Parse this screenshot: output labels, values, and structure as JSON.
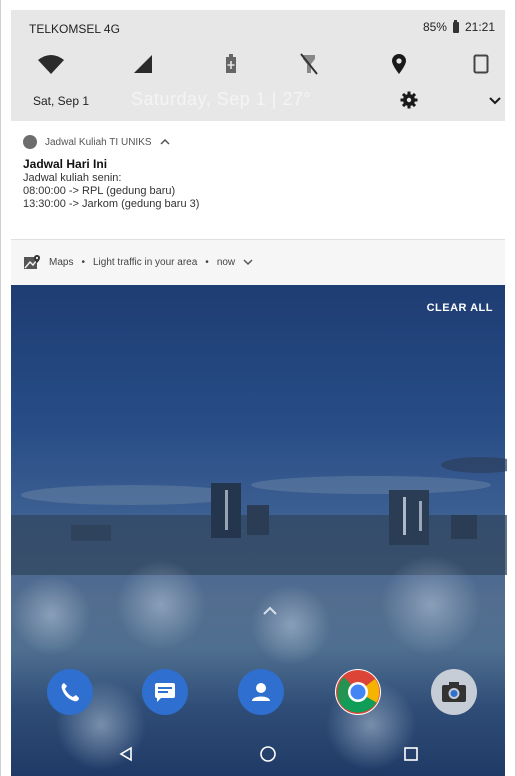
{
  "status_bar": {
    "carrier": "TELKOMSEL 4G",
    "battery": "85%",
    "time": "21:21"
  },
  "quick_settings": {
    "date": "Sat, Sep 1",
    "ghost_text": "Saturday, Sep 1 | 27°",
    "tiles": [
      "wifi-icon",
      "cellular-signal-icon",
      "battery-saver-icon",
      "flashlight-off-icon",
      "location-icon",
      "auto-rotate-icon"
    ]
  },
  "notifications": [
    {
      "app": "Jadwal Kuliah TI UNIKS",
      "title": "Jadwal Hari Ini",
      "lines": [
        "Jadwal kuliah senin:",
        "08:00:00 -> RPL (gedung baru)",
        "13:30:00 -> Jarkom (gedung baru 3)"
      ]
    },
    {
      "app": "Maps",
      "text": "Light traffic in your area",
      "when": "now"
    }
  ],
  "home": {
    "clear_all": "CLEAR ALL",
    "dock": [
      "phone-icon",
      "messages-icon",
      "contacts-icon",
      "chrome-icon",
      "camera-icon"
    ],
    "colors": {
      "dock_blue": "#2f6fcf",
      "chrome_red": "#db4437",
      "chrome_yellow": "#f4b400",
      "chrome_green": "#0f9d58",
      "chrome_blue": "#4285f4"
    }
  }
}
